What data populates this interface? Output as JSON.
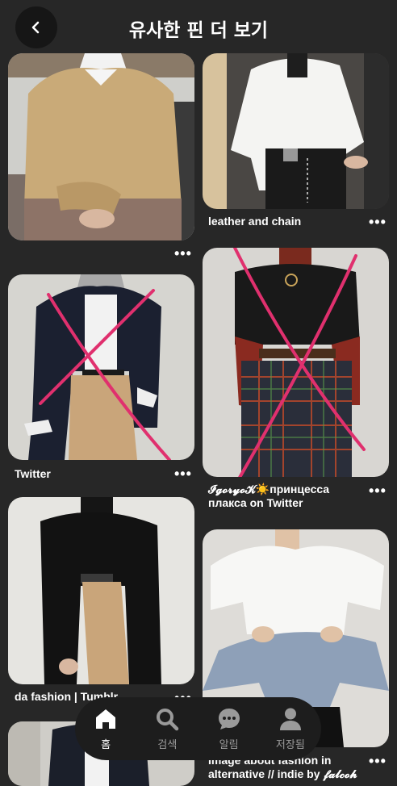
{
  "header": {
    "title": "유사한 핀 더 보기"
  },
  "pins": [
    {
      "caption": "",
      "more": "•••"
    },
    {
      "caption": "leather and chain",
      "more": "•••"
    },
    {
      "caption": "Twitter",
      "more": "•••"
    },
    {
      "caption_line1": "𝓘𝓰𝓸𝓻𝔂𝓸𝓚☀️принцесса",
      "caption_line2": "плакса on Twitter",
      "more": "•••"
    },
    {
      "caption": "da fashion | Tumblr",
      "more": "•••"
    },
    {
      "caption_line1": "Image about fashion in",
      "caption_line2": "alternative // indie by 𝓯𝓪𝓵𝓬𝓸𝓱",
      "more": "•••"
    }
  ],
  "nav": {
    "home": "홈",
    "search": "검색",
    "notifications": "알림",
    "saved": "저장됨"
  },
  "colors": {
    "background": "#272727",
    "navbar": "#1d1d1d",
    "cross": "#e0306e"
  }
}
